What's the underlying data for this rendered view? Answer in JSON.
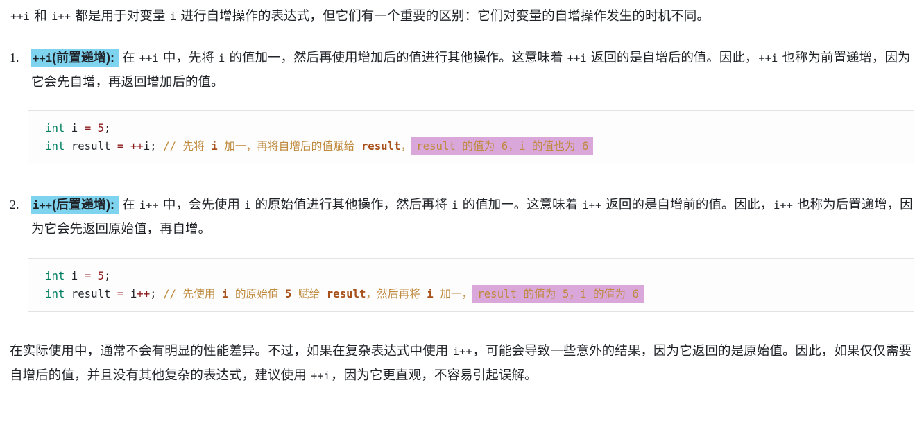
{
  "document": {
    "intro": {
      "segments": [
        {
          "type": "code",
          "text": "++i"
        },
        {
          "type": "text",
          "text": " 和 "
        },
        {
          "type": "code",
          "text": "i++"
        },
        {
          "type": "text",
          "text": " 都是用于对变量 "
        },
        {
          "type": "code",
          "text": "i"
        },
        {
          "type": "text",
          "text": " 进行自增操作的表达式，但它们有一个重要的区别：它们对变量的自增操作发生的时机不同。"
        }
      ],
      "plain": "++i 和 i++ 都是用于对变量 i 进行自增操作的表达式，但它们有一个重要的区别：它们对变量的自增操作发生的时机不同。"
    },
    "list": [
      {
        "number": "1.",
        "lead_code": "++i",
        "lead_label": "(前置递增):",
        "body_segments": [
          {
            "type": "text",
            "text": " 在 "
          },
          {
            "type": "code",
            "text": "++i"
          },
          {
            "type": "text",
            "text": " 中，先将 "
          },
          {
            "type": "code",
            "text": "i"
          },
          {
            "type": "text",
            "text": " 的值加一，然后再使用增加后的值进行其他操作。这意味着 "
          },
          {
            "type": "code",
            "text": "++i"
          },
          {
            "type": "text",
            "text": " 返回的是自增后的值。因此，"
          },
          {
            "type": "code",
            "text": "++i"
          },
          {
            "type": "text",
            "text": " 也称为前置递增，因为它会先自增，再返回增加后的值。"
          }
        ],
        "body_plain": "在 ++i 中，先将 i 的值加一，然后再使用增加后的值进行其他操作。这意味着 ++i 返回的是自增后的值。因此，++i 也称为前置递增，因为它会先自增，再返回增加后的值。"
      },
      {
        "number": "2.",
        "lead_code": "i++",
        "lead_label": "(后置递增):",
        "body_segments": [
          {
            "type": "text",
            "text": " 在 "
          },
          {
            "type": "code",
            "text": "i++"
          },
          {
            "type": "text",
            "text": " 中，会先使用 "
          },
          {
            "type": "code",
            "text": "i"
          },
          {
            "type": "text",
            "text": " 的原始值进行其他操作，然后再将 "
          },
          {
            "type": "code",
            "text": "i"
          },
          {
            "type": "text",
            "text": " 的值加一。这意味着 "
          },
          {
            "type": "code",
            "text": "i++"
          },
          {
            "type": "text",
            "text": " 返回的是自增前的值。因此，"
          },
          {
            "type": "code",
            "text": "i++"
          },
          {
            "type": "text",
            "text": " 也称为后置递增，因为它会先返回原始值，再自增。"
          }
        ],
        "body_plain": "在 i++ 中，会先使用 i 的原始值进行其他操作，然后再将 i 的值加一。这意味着 i++ 返回的是自增前的值。因此，i++ 也称为后置递增，因为它会先返回原始值，再自增。"
      }
    ],
    "code_blocks": [
      {
        "language": "c",
        "lines": [
          [
            {
              "cls": "tok-kw",
              "text": "int"
            },
            {
              "cls": "tok-punc",
              "text": " "
            },
            {
              "cls": "tok-ident",
              "text": "i"
            },
            {
              "cls": "tok-punc",
              "text": " "
            },
            {
              "cls": "tok-op",
              "text": "="
            },
            {
              "cls": "tok-punc",
              "text": " "
            },
            {
              "cls": "tok-num",
              "text": "5"
            },
            {
              "cls": "tok-punc",
              "text": ";"
            }
          ],
          [
            {
              "cls": "tok-kw",
              "text": "int"
            },
            {
              "cls": "tok-punc",
              "text": " "
            },
            {
              "cls": "tok-ident",
              "text": "result"
            },
            {
              "cls": "tok-punc",
              "text": " "
            },
            {
              "cls": "tok-op",
              "text": "="
            },
            {
              "cls": "tok-punc",
              "text": " "
            },
            {
              "cls": "tok-op",
              "text": "++"
            },
            {
              "cls": "tok-ident",
              "text": "i"
            },
            {
              "cls": "tok-punc",
              "text": ";"
            },
            {
              "cls": "tok-punc",
              "text": " "
            },
            {
              "cls": "tok-comment",
              "text": "// 先将 "
            },
            {
              "cls": "tok-comment cmt-strong",
              "text": "i"
            },
            {
              "cls": "tok-comment",
              "text": " 加一，再将自增后的值赋给 "
            },
            {
              "cls": "tok-comment cmt-strong",
              "text": "result"
            },
            {
              "cls": "tok-comment",
              "text": "，"
            },
            {
              "cls": "tok-comment highlight",
              "text": "result 的值为 6，i 的值也为 6"
            }
          ]
        ],
        "plain": "int i = 5;\nint result = ++i; // 先将 i 加一，再将自增后的值赋给 result，result 的值为 6，i 的值也为 6"
      },
      {
        "language": "c",
        "lines": [
          [
            {
              "cls": "tok-kw",
              "text": "int"
            },
            {
              "cls": "tok-punc",
              "text": " "
            },
            {
              "cls": "tok-ident",
              "text": "i"
            },
            {
              "cls": "tok-punc",
              "text": " "
            },
            {
              "cls": "tok-op",
              "text": "="
            },
            {
              "cls": "tok-punc",
              "text": " "
            },
            {
              "cls": "tok-num",
              "text": "5"
            },
            {
              "cls": "tok-punc",
              "text": ";"
            }
          ],
          [
            {
              "cls": "tok-kw",
              "text": "int"
            },
            {
              "cls": "tok-punc",
              "text": " "
            },
            {
              "cls": "tok-ident",
              "text": "result"
            },
            {
              "cls": "tok-punc",
              "text": " "
            },
            {
              "cls": "tok-op",
              "text": "="
            },
            {
              "cls": "tok-punc",
              "text": " "
            },
            {
              "cls": "tok-ident",
              "text": "i"
            },
            {
              "cls": "tok-op",
              "text": "++"
            },
            {
              "cls": "tok-punc",
              "text": ";"
            },
            {
              "cls": "tok-punc",
              "text": " "
            },
            {
              "cls": "tok-comment",
              "text": "// 先使用 "
            },
            {
              "cls": "tok-comment cmt-strong",
              "text": "i"
            },
            {
              "cls": "tok-comment",
              "text": " 的原始值 "
            },
            {
              "cls": "tok-comment cmt-strong",
              "text": "5"
            },
            {
              "cls": "tok-comment",
              "text": " 赋给 "
            },
            {
              "cls": "tok-comment cmt-strong",
              "text": "result"
            },
            {
              "cls": "tok-comment",
              "text": "，然后再将 "
            },
            {
              "cls": "tok-comment cmt-strong",
              "text": "i"
            },
            {
              "cls": "tok-comment",
              "text": " 加一，"
            },
            {
              "cls": "tok-comment highlight",
              "text": "result 的值为 5，i 的值为 6"
            }
          ]
        ],
        "plain": "int i = 5;\nint result = i++; // 先使用 i 的原始值 5 赋给 result，然后再将 i 加一，result 的值为 5，i 的值为 6"
      }
    ],
    "closing": {
      "segments": [
        {
          "type": "text",
          "text": "在实际使用中，通常不会有明显的性能差异。不过，如果在复杂表达式中使用 "
        },
        {
          "type": "code",
          "text": "i++"
        },
        {
          "type": "text",
          "text": "，可能会导致一些意外的结果，因为它返回的是原始值。因此，如果仅仅需要自增后的值，并且没有其他复杂的表达式，建议使用 "
        },
        {
          "type": "code",
          "text": "++i"
        },
        {
          "type": "text",
          "text": "，因为它更直观，不容易引起误解。"
        }
      ],
      "plain": "在实际使用中，通常不会有明显的性能差异。不过，如果在复杂表达式中使用 i++，可能会导致一些意外的结果，因为它返回的是原始值。因此，如果仅仅需要自增后的值，并且没有其他复杂的表达式，建议使用 ++i，因为它更直观，不容易引起误解。"
    }
  },
  "colors": {
    "text": "#1f2328",
    "lead_highlight": "#7ed3ef",
    "comment_highlight": "#d9a7d9",
    "keyword": "#007f5f",
    "operator": "#8b1a1a",
    "comment": "#bf8a3d",
    "comment_code": "#a8501a",
    "code_block_bg": "#fdfdfe",
    "code_block_border": "#e3e3e6",
    "page_bg": "#ffffff"
  }
}
